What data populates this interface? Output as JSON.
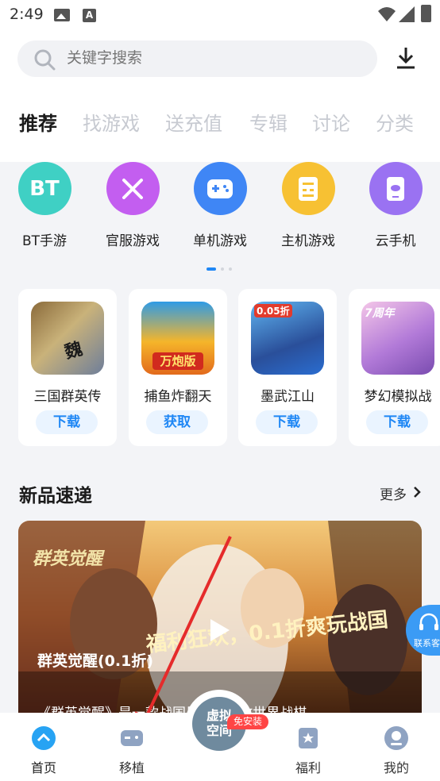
{
  "status_bar": {
    "time": "2:49"
  },
  "search": {
    "placeholder": "关键字搜索"
  },
  "tabs": [
    {
      "label": "推荐",
      "active": true
    },
    {
      "label": "找游戏"
    },
    {
      "label": "送充值"
    },
    {
      "label": "专辑"
    },
    {
      "label": "讨论"
    },
    {
      "label": "分类"
    }
  ],
  "categories": [
    {
      "label": "BT手游",
      "icon_text": "BT",
      "icon": "bt-icon",
      "color": "#3fd0c4"
    },
    {
      "label": "官服游戏",
      "icon": "crossed-swords-icon",
      "color": "#c35ef0"
    },
    {
      "label": "单机游戏",
      "icon": "gamepad-icon",
      "color": "#3f86f5"
    },
    {
      "label": "主机游戏",
      "icon": "console-icon",
      "color": "#f7c133"
    },
    {
      "label": "云手机",
      "icon": "cloud-phone-icon",
      "color": "#9a72f2"
    }
  ],
  "games": [
    {
      "name": "三国群英传",
      "action": "下载",
      "thumb_text": "魏"
    },
    {
      "name": "捕鱼炸翻天",
      "action": "获取",
      "thumb_text": "万炮版"
    },
    {
      "name": "墨武江山",
      "action": "下载",
      "thumb_text": "0.05折"
    },
    {
      "name": "梦幻模拟战",
      "action": "下载",
      "thumb_text": "7周年"
    }
  ],
  "section": {
    "title": "新品速递",
    "more": "更多"
  },
  "banner": {
    "title": "群英觉醒(0.1折)",
    "description": "《群英觉醒》是一款战国风格...开放世界战棋",
    "logo_text": "群英觉醒",
    "slogan": "福利狂欢，0.1折爽玩战国"
  },
  "service": {
    "label": "联系客服"
  },
  "bottom_nav": [
    {
      "label": "首页",
      "icon": "home-icon",
      "active": true
    },
    {
      "label": "移植",
      "icon": "port-icon"
    },
    {
      "label": "福利",
      "icon": "gift-icon"
    },
    {
      "label": "我的",
      "icon": "profile-icon"
    }
  ],
  "center_button": {
    "label": "虚拟空间",
    "badge": "免安装"
  }
}
